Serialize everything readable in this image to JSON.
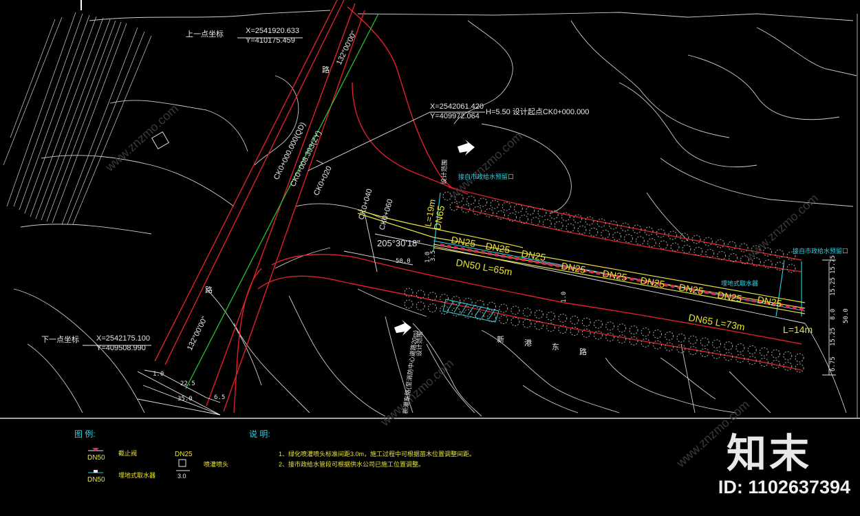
{
  "coords": {
    "top_point_label": "上一点坐标",
    "top_point_x": "X=2541920.633",
    "top_point_y": "Y=410175.459",
    "bottom_point_label": "下一点坐标",
    "bottom_point_x": "X=2542175.100",
    "bottom_point_y": "Y=409508.990",
    "design_point_x": "X=2542061.420",
    "design_point_y": "Y=409972.064",
    "design_start": "H=5.50  设计起点CK0+000.000"
  },
  "stations": [
    "CK0+000.000(QD)",
    "CK0+008.393(ZY)",
    "CK0+020",
    "CK0+040",
    "CK0+060"
  ],
  "bearings": {
    "top": "132°00'00\"",
    "bottom": "132°00'00\"",
    "angle": "205°30'18\""
  },
  "road_labels": {
    "upper": "路",
    "lower": "路",
    "new_road": [
      "新",
      "港",
      "东",
      "路"
    ]
  },
  "pipe_labels": {
    "main_left": "DN50  L=65m",
    "main_right": "DN65  L=73m",
    "branch": "DN65",
    "branch_length": "L=19m",
    "end_length": "L=14m",
    "sprinkler": "DN25"
  },
  "annotations": {
    "connect_top": "接自市政给水预留口",
    "connect_right": "接自市政给水预留口",
    "valve": "埋地式取水器",
    "design_boundary_top": "设计范围",
    "design_boundary_bottom": "设计范围",
    "fire_route": "新港东路(至消防中心道路20m)"
  },
  "dims": {
    "d50": "50.0",
    "d225": "22.5",
    "d350": "35.0",
    "d65": "6.5",
    "r1575": "15.75",
    "r1525": "15.25",
    "r80": "8.0",
    "r500": "50.0",
    "r1525b": "15.25",
    "r675": "6.75",
    "m10": "1.0",
    "m10b": "1.0",
    "m35": "3.5",
    "m10c": "1.0",
    "m500": "50.0"
  },
  "legend": {
    "title": "图 例:",
    "items": [
      {
        "code": "DN50",
        "label": "截止阀"
      },
      {
        "code": "DN50",
        "label": "埋地式取水器"
      },
      {
        "code": "DN25",
        "label": "喷灌喷头",
        "spacing": "3.0"
      }
    ]
  },
  "notes": {
    "title": "说 明:",
    "lines": [
      "1、绿化喷灌喷头标准间距3.0m，施工过程中可根据苗木位置调整间距。",
      "2、接市政给水管段可根据供水公司已施工位置调整。"
    ]
  },
  "watermark": {
    "logo": "知末",
    "id": "ID: 1102637394",
    "site": "www.znzmo.com"
  },
  "colors": {
    "road": "#e0202a",
    "centerline": "#22c233",
    "pipe": "#e8e23a",
    "cyan": "#28d6e6",
    "white": "#e8e8e8",
    "tree": "#a8a8a8",
    "bg": "#000000"
  }
}
